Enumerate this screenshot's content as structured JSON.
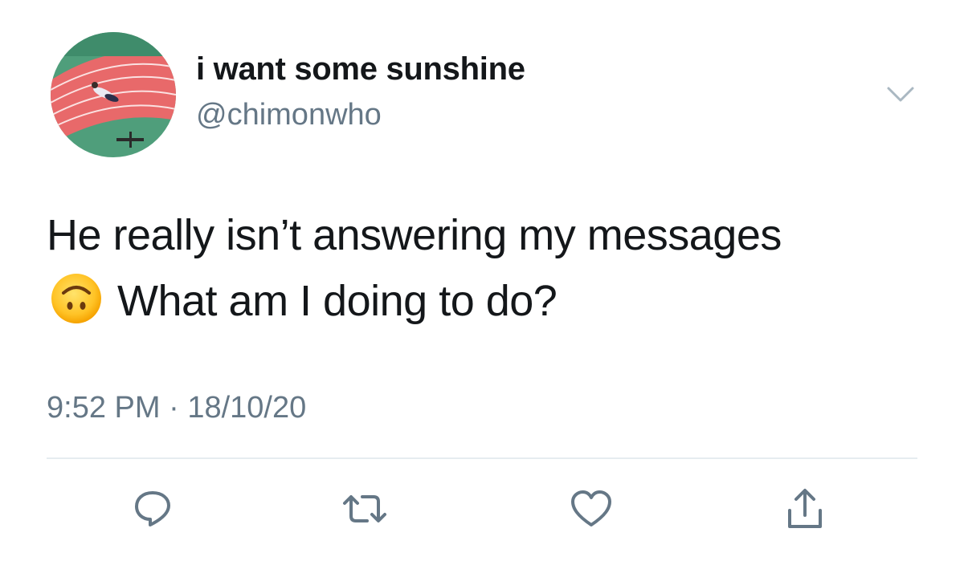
{
  "tweet": {
    "display_name": "i want some sunshine",
    "handle": "@chimonwho",
    "text_line1": "He really isn’t answering my messages",
    "text_line2": "What am I doing to do?",
    "emoji": "upside-down-face",
    "time": "9:52 PM",
    "separator": "·",
    "date": "18/10/20"
  },
  "icons": {
    "more": "chevron-down-icon",
    "reply": "reply-icon",
    "retweet": "retweet-icon",
    "like": "heart-icon",
    "share": "share-icon"
  },
  "colors": {
    "text": "#14171a",
    "secondary": "#657786",
    "divider": "#e6ecf0",
    "icon": "#657786"
  }
}
